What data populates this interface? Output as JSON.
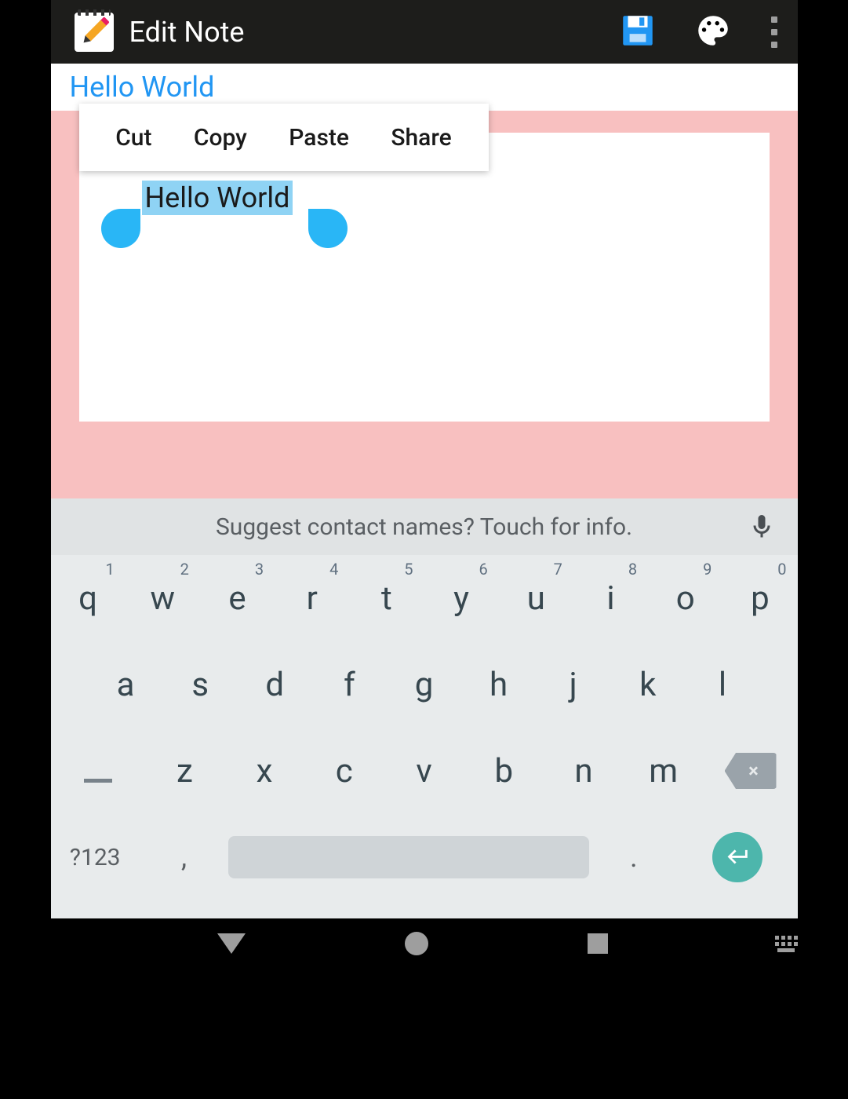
{
  "appbar": {
    "title": "Edit Note",
    "icons": {
      "save": "save-icon",
      "palette": "palette-icon",
      "overflow": "overflow-icon",
      "app": "notepad-pencil-icon"
    }
  },
  "note": {
    "title": "Hello World",
    "selected_text": "Hello World",
    "background_color": "#f8c0c0"
  },
  "context_menu": {
    "cut": "Cut",
    "copy": "Copy",
    "paste": "Paste",
    "share": "Share"
  },
  "keyboard": {
    "suggestion": "Suggest contact names? Touch for info.",
    "row1": [
      {
        "k": "q",
        "n": "1"
      },
      {
        "k": "w",
        "n": "2"
      },
      {
        "k": "e",
        "n": "3"
      },
      {
        "k": "r",
        "n": "4"
      },
      {
        "k": "t",
        "n": "5"
      },
      {
        "k": "y",
        "n": "6"
      },
      {
        "k": "u",
        "n": "7"
      },
      {
        "k": "i",
        "n": "8"
      },
      {
        "k": "o",
        "n": "9"
      },
      {
        "k": "p",
        "n": "0"
      }
    ],
    "row2": [
      "a",
      "s",
      "d",
      "f",
      "g",
      "h",
      "j",
      "k",
      "l"
    ],
    "row3": [
      "z",
      "x",
      "c",
      "v",
      "b",
      "n",
      "m"
    ],
    "symbols_key": "?123",
    "comma_key": ",",
    "period_key": "."
  },
  "colors": {
    "accent_blue": "#2196f3",
    "selection_blue": "#8fd3f4",
    "handle_blue": "#29b6f6",
    "enter_teal": "#4db6ac"
  }
}
